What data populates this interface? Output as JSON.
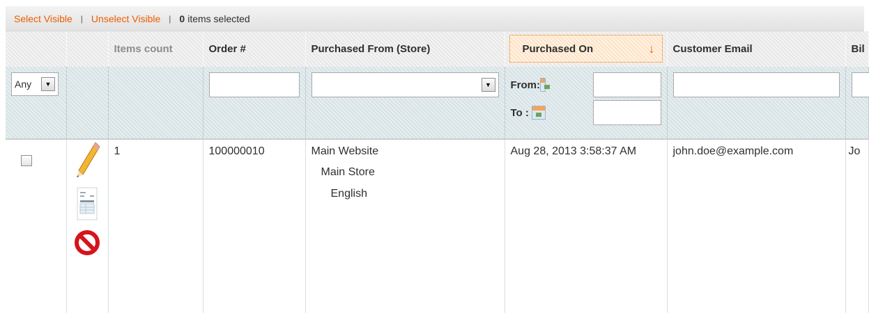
{
  "massaction": {
    "select_visible": "Select Visible",
    "separator": "|",
    "unselect_visible": "Unselect Visible",
    "selected_count": "0",
    "selected_text": "items selected"
  },
  "columns": {
    "items_count": "Items count",
    "order_num": "Order #",
    "purchased_from": "Purchased From (Store)",
    "purchased_on": "Purchased On",
    "customer_email": "Customer Email",
    "billing": "Bil"
  },
  "sort_icon": "arrow-down-icon",
  "filters": {
    "any_select": "Any",
    "from_label": "From:",
    "to_label": "To :"
  },
  "row": {
    "items_count": "1",
    "order_num": "100000010",
    "store_website": "Main Website",
    "store_store": "Main Store",
    "store_view": "English",
    "purchased_on": "Aug 28, 2013 3:58:37 AM",
    "customer_email": "john.doe@example.com",
    "billing": "Jo"
  },
  "icons": [
    "pencil-icon",
    "invoice-icon",
    "cancel-icon",
    "calendar-icon"
  ],
  "colors": {
    "accent": "#eb5e00",
    "cancel_red": "#d6141b"
  }
}
